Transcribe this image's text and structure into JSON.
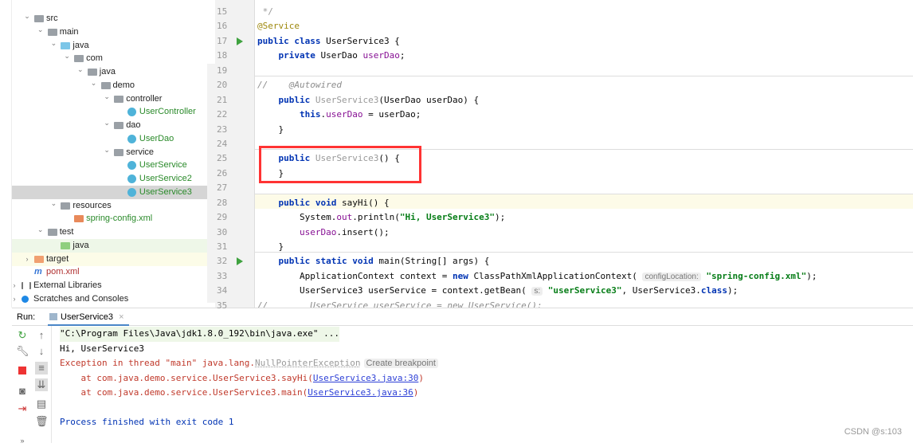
{
  "project_tree": {
    "items": [
      {
        "label": "src",
        "level": 0,
        "icon": "folder-icon",
        "expanded": true
      },
      {
        "label": "main",
        "level": 1,
        "icon": "folder-icon",
        "expanded": true
      },
      {
        "label": "java",
        "level": 2,
        "icon": "source-folder-icon",
        "expanded": true
      },
      {
        "label": "com",
        "level": 3,
        "icon": "package-icon",
        "expanded": true
      },
      {
        "label": "java",
        "level": 4,
        "icon": "package-icon",
        "expanded": true
      },
      {
        "label": "demo",
        "level": 5,
        "icon": "package-icon",
        "expanded": true
      },
      {
        "label": "controller",
        "level": 6,
        "icon": "package-icon",
        "expanded": true
      },
      {
        "label": "UserController",
        "level": 7,
        "icon": "class-icon"
      },
      {
        "label": "dao",
        "level": 6,
        "icon": "package-icon",
        "expanded": true
      },
      {
        "label": "UserDao",
        "level": 7,
        "icon": "class-icon"
      },
      {
        "label": "service",
        "level": 6,
        "icon": "package-icon",
        "expanded": true
      },
      {
        "label": "UserService",
        "level": 7,
        "icon": "runnable-class-icon"
      },
      {
        "label": "UserService2",
        "level": 7,
        "icon": "runnable-class-icon"
      },
      {
        "label": "UserService3",
        "level": 7,
        "icon": "runnable-class-icon",
        "selected": true
      },
      {
        "label": "resources",
        "level": 2,
        "icon": "resources-folder-icon",
        "expanded": true
      },
      {
        "label": "spring-config.xml",
        "level": 3,
        "icon": "xml-file-icon"
      },
      {
        "label": "test",
        "level": 1,
        "icon": "folder-icon",
        "expanded": true
      },
      {
        "label": "java",
        "level": 2,
        "icon": "test-source-folder-icon"
      },
      {
        "label": "target",
        "level": 0,
        "icon": "excluded-folder-icon",
        "expanded": false
      },
      {
        "label": "pom.xml",
        "level": 0,
        "icon": "maven-icon"
      },
      {
        "label": "External Libraries",
        "level": -1,
        "icon": "libraries-icon",
        "expanded": false
      },
      {
        "label": "Scratches and Consoles",
        "level": -1,
        "icon": "scratches-icon",
        "expanded": false
      }
    ]
  },
  "editor": {
    "lines": [
      {
        "n": "15",
        "tokens": [
          [
            "gr",
            " */"
          ]
        ]
      },
      {
        "n": "16",
        "tokens": [
          [
            "an",
            "@Service"
          ]
        ]
      },
      {
        "n": "17",
        "run": true,
        "tokens": [
          [
            "kw",
            "public class "
          ],
          [
            "",
            "UserService3 {"
          ]
        ]
      },
      {
        "n": "18",
        "tokens": [
          [
            "",
            "    "
          ],
          [
            "kw",
            "private "
          ],
          [
            "",
            "UserDao "
          ],
          [
            "fd",
            "userDao"
          ],
          [
            "",
            ";"
          ]
        ]
      },
      {
        "n": "19",
        "tokens": []
      },
      {
        "n": "20",
        "tokens": [
          [
            "cm",
            "//    @Autowired"
          ]
        ]
      },
      {
        "n": "21",
        "tokens": [
          [
            "",
            "    "
          ],
          [
            "kw",
            "public "
          ],
          [
            "gr",
            "UserService3"
          ],
          [
            "",
            "(UserDao userDao) {"
          ]
        ]
      },
      {
        "n": "22",
        "tokens": [
          [
            "",
            "        "
          ],
          [
            "kw",
            "this"
          ],
          [
            "",
            "."
          ],
          [
            "fd",
            "userDao"
          ],
          [
            "",
            " = userDao;"
          ]
        ]
      },
      {
        "n": "23",
        "tokens": [
          [
            "",
            "    }"
          ]
        ]
      },
      {
        "n": "24",
        "tokens": []
      },
      {
        "n": "25",
        "tokens": [
          [
            "",
            "    "
          ],
          [
            "kw",
            "public "
          ],
          [
            "gr",
            "UserService3"
          ],
          [
            "",
            "() {"
          ]
        ]
      },
      {
        "n": "26",
        "tokens": [
          [
            "",
            "    }"
          ]
        ]
      },
      {
        "n": "27",
        "tokens": []
      },
      {
        "n": "28",
        "tokens": [
          [
            "",
            "    "
          ],
          [
            "kw",
            "public void "
          ],
          [
            "",
            "sayHi() {"
          ]
        ]
      },
      {
        "n": "29",
        "tokens": [
          [
            "",
            "        System."
          ],
          [
            "fd",
            "out"
          ],
          [
            "",
            ".println("
          ],
          [
            "st",
            "\"Hi, UserService3\""
          ],
          [
            "",
            ");"
          ]
        ]
      },
      {
        "n": "30",
        "tokens": [
          [
            "",
            "        "
          ],
          [
            "fd",
            "userDao"
          ],
          [
            "",
            ".insert();"
          ]
        ]
      },
      {
        "n": "31",
        "tokens": [
          [
            "",
            "    }"
          ]
        ]
      },
      {
        "n": "32",
        "run": true,
        "tokens": [
          [
            "",
            "    "
          ],
          [
            "kw",
            "public static void "
          ],
          [
            "",
            "main(String[] args) {"
          ]
        ]
      },
      {
        "n": "33",
        "tokens": [
          [
            "",
            "        ApplicationContext context = "
          ],
          [
            "kw",
            "new "
          ],
          [
            "",
            "ClassPathXmlApplicationContext( "
          ],
          [
            "hint",
            "configLocation:"
          ],
          [
            "",
            " "
          ],
          [
            "st",
            "\"spring-config.xml\""
          ],
          [
            "",
            ");"
          ]
        ]
      },
      {
        "n": "34",
        "tokens": [
          [
            "",
            "        UserService3 userService = context.getBean( "
          ],
          [
            "hint",
            "s:"
          ],
          [
            "",
            " "
          ],
          [
            "st",
            "\"userService3\""
          ],
          [
            "",
            ", UserService3."
          ],
          [
            "kw",
            "class"
          ],
          [
            "",
            ");"
          ]
        ]
      },
      {
        "n": "35",
        "tokens": [
          [
            "cm",
            "//        UserService userService = new UserService();"
          ]
        ]
      }
    ]
  },
  "run_panel": {
    "label": "Run:",
    "tab": "UserService3",
    "console": [
      {
        "text": "\"C:\\Program Files\\Java\\jdk1.8.0_192\\bin\\java.exe\" ...",
        "color": "#000"
      },
      {
        "text": "Hi, UserService3",
        "color": "#000"
      },
      {
        "text": "Exception in thread \"main\" java.lang.",
        "exc": "NullPointerException",
        "hint": "Create breakpoint",
        "color": "#c0392b"
      },
      {
        "text": "    at com.java.demo.service.UserService3.sayHi(",
        "link": "UserService3.java:30",
        "after": ")",
        "color": "#c0392b"
      },
      {
        "text": "    at com.java.demo.service.UserService3.main(",
        "link": "UserService3.java:36",
        "after": ")",
        "color": "#c0392b"
      },
      {
        "text": "Process finished with exit code 1",
        "color": "#0033b3"
      }
    ]
  },
  "watermark": "CSDN @s:103"
}
